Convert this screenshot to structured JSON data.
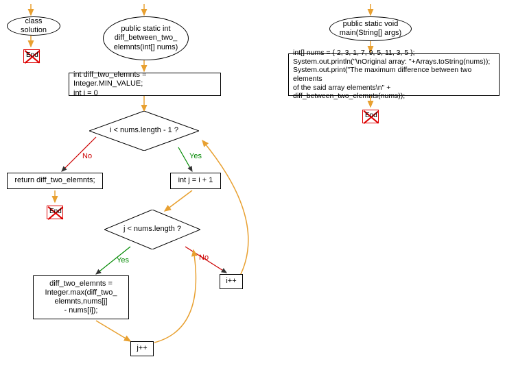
{
  "diagram": {
    "nodes": {
      "class_solution": "class solution",
      "end": "End",
      "func_diff": "public static int\ndiff_between_two_\nelemnts(int[] nums)",
      "init_block": "int diff_two_elemnts = Integer.MIN_VALUE;\nint i = 0",
      "cond_i": "i < nums.length - 1 ?",
      "return_stmt": "return diff_two_elemnts;",
      "int_j": "int j = i + 1",
      "cond_j": "j < nums.length ?",
      "max_block": "diff_two_elemnts =\nInteger.max(diff_two_\nelemnts,nums[j]\n- nums[i]);",
      "i_inc": "i++",
      "j_inc": "j++",
      "func_main": "public static void\nmain(String[] args)",
      "main_body": "int[] nums = { 2, 3, 1, 7, 9, 5, 11, 3, 5 };\nSystem.out.println(\"\\nOriginal array: \"+Arrays.toString(nums));\nSystem.out.print(\"The maximum difference between two elements\nof the said array elements\\n\" + diff_between_two_elemnts(nums));"
    },
    "labels": {
      "yes": "Yes",
      "no": "No"
    }
  }
}
